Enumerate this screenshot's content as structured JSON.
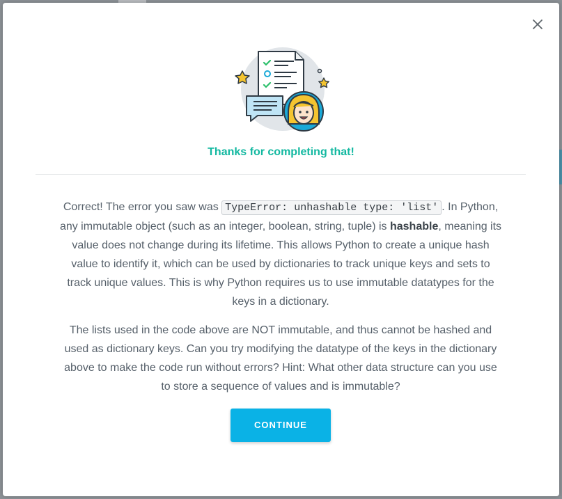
{
  "modal": {
    "title": "Thanks for completing that!",
    "paragraph1": {
      "prefix": "Correct! The error you saw was ",
      "code": "TypeError: unhashable type: 'list'",
      "middle": ". In Python, any immutable object (such as an integer, boolean, string, tuple) is ",
      "bold": "hashable",
      "suffix": ", meaning its value does not change during its lifetime. This allows Python to create a unique hash value to identify it, which can be used by dictionaries to track unique keys and sets to track unique values. This is why Python requires us to use immutable datatypes for the keys in a dictionary."
    },
    "paragraph2": "The lists used in the code above are NOT immutable, and thus cannot be hashed and used as dictionary keys. Can you try modifying the datatype of the keys in the dictionary above to make the code run without errors? Hint: What other data structure can you use to store a sequence of values and is immutable?",
    "continue_label": "CONTINUE",
    "close_icon": "close-icon",
    "illustration_icon": "completion-illustration-icon"
  },
  "colors": {
    "accent_teal": "#12b8a0",
    "button_blue": "#0ab2e6",
    "text_gray": "#56606a"
  }
}
